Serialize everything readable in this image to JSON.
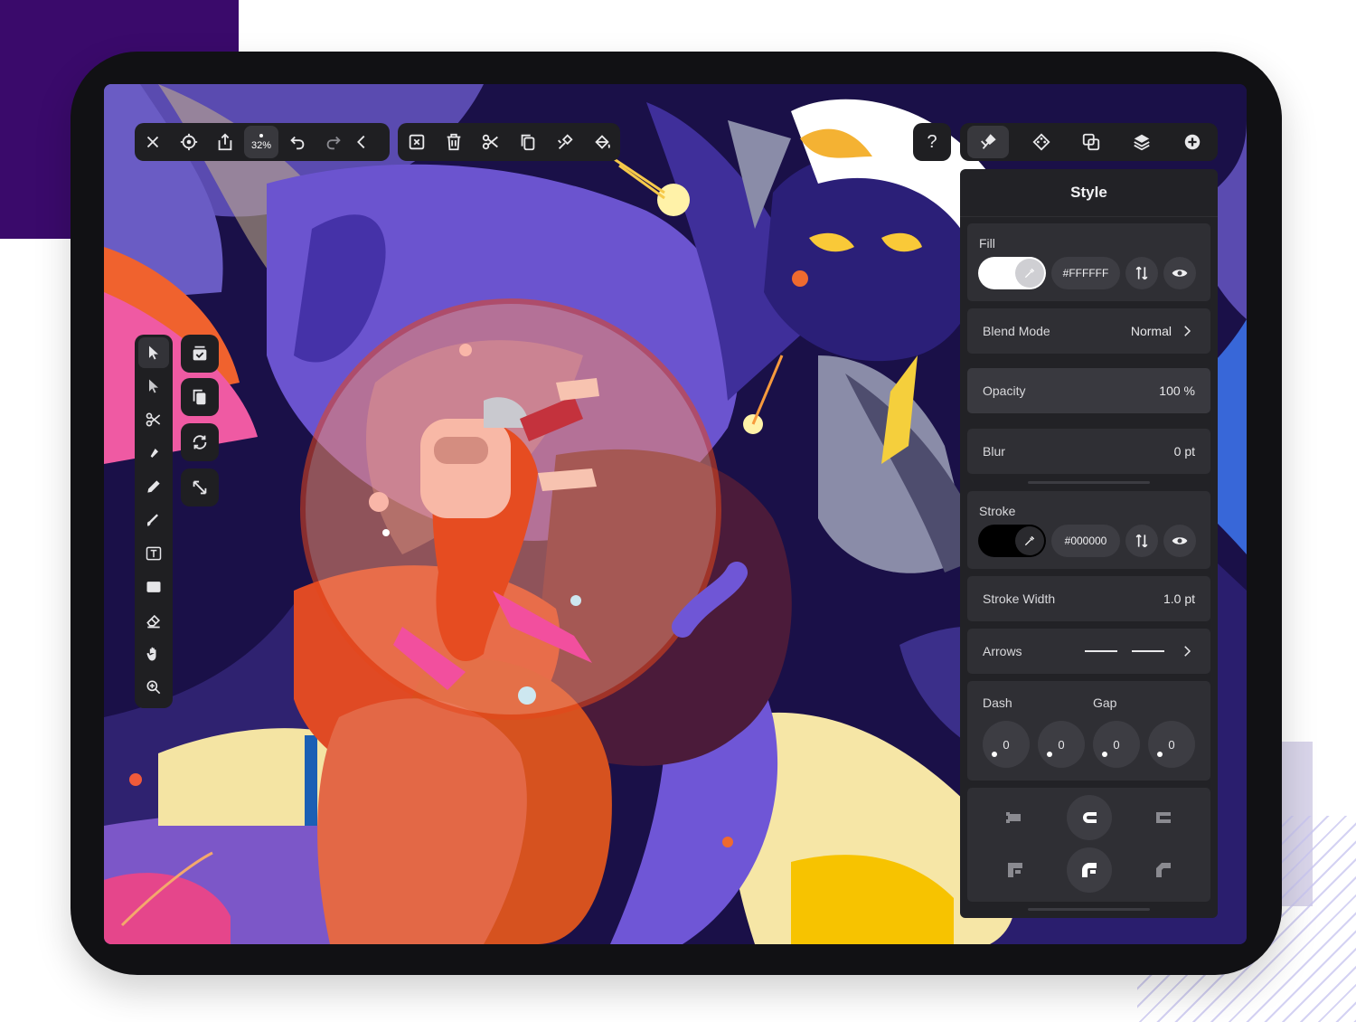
{
  "top_toolbar": {
    "zoom_label": "32%"
  },
  "help_label": "?",
  "panel": {
    "title": "Style",
    "fill": {
      "label": "Fill",
      "hex": "#FFFFFF",
      "color": "#ffffff"
    },
    "blend_mode": {
      "label": "Blend Mode",
      "value": "Normal"
    },
    "opacity": {
      "label": "Opacity",
      "value": "100 %"
    },
    "blur": {
      "label": "Blur",
      "value": "0 pt"
    },
    "stroke": {
      "label": "Stroke",
      "hex": "#000000",
      "color": "#000000"
    },
    "stroke_width": {
      "label": "Stroke Width",
      "value": "1.0 pt"
    },
    "arrows": {
      "label": "Arrows"
    },
    "dash": {
      "label": "Dash",
      "gap_label": "Gap",
      "values": [
        "0",
        "0",
        "0",
        "0"
      ]
    }
  },
  "colors": {
    "accent_purple": "#3a0a6b",
    "panel_bg": "#222226",
    "card_bg": "#2f2f34"
  }
}
